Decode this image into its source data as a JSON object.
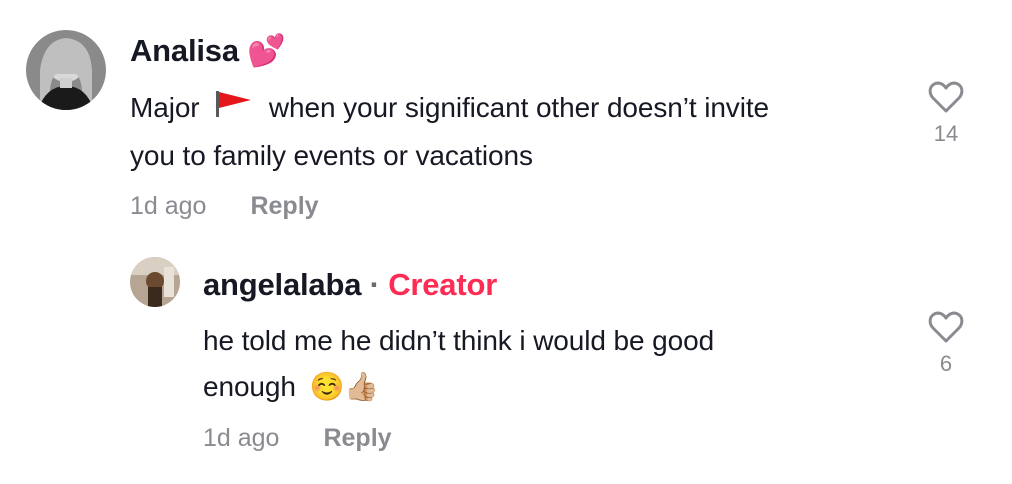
{
  "comments": [
    {
      "username": "Analisa",
      "name_emoji": "💕",
      "text_before_flag": "Major",
      "flag_icon": "red-flag",
      "text_line1_rest": "when your significant other doesn’t invite",
      "text_line2": "you to family events or vacations",
      "time": "1d ago",
      "reply_label": "Reply",
      "likes": "14"
    },
    {
      "username": "angelalaba",
      "separator": "·",
      "badge": "Creator",
      "text_line1": "he told me he didn’t think i would be good",
      "text_line2": "enough",
      "emoji_1": "☺️",
      "emoji_2": "👍🏼",
      "time": "1d ago",
      "reply_label": "Reply",
      "likes": "6"
    }
  ],
  "icons": [
    "heart-outline-icon",
    "red-flag-icon"
  ],
  "colors": {
    "text": "#161823",
    "muted": "#8a8b91",
    "creator": "#fe2c55",
    "flag": "#e4161b"
  }
}
